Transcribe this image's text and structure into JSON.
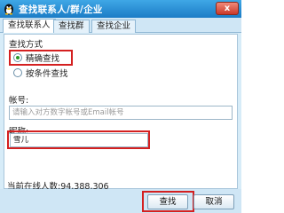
{
  "window": {
    "title": "查找联系人/群/企业",
    "close_label": "x"
  },
  "tabs": [
    {
      "label": "查找联系人"
    },
    {
      "label": "查找群"
    },
    {
      "label": "查找企业"
    }
  ],
  "search_mode": {
    "label": "查找方式",
    "options": [
      {
        "label": "精确查找",
        "checked": true
      },
      {
        "label": "按条件查找",
        "checked": false
      }
    ]
  },
  "account": {
    "label": "帐号:",
    "placeholder": "请输入对方数字帐号或Email帐号"
  },
  "nickname": {
    "label": "昵称:",
    "value": "雪儿"
  },
  "status": {
    "online_count": "当前在线人数:94,388,306"
  },
  "buttons": {
    "search": "查找",
    "cancel": "取消"
  },
  "colors": {
    "titlebar": "#1b7cc6",
    "highlight": "#d42020"
  }
}
